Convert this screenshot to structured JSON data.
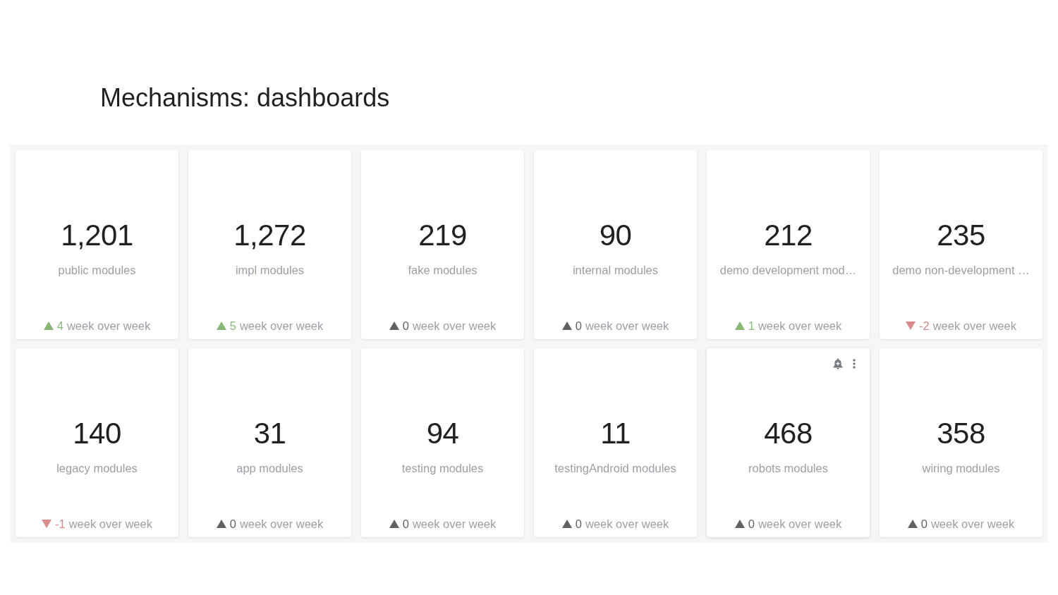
{
  "title": "Mechanisms: dashboards",
  "cards": [
    {
      "value": "1,201",
      "label": "public modules",
      "kind": "up",
      "delta": "4",
      "period": "week over week",
      "actions_shown": false
    },
    {
      "value": "1,272",
      "label": "impl modules",
      "kind": "up",
      "delta": "5",
      "period": "week over week",
      "actions_shown": false
    },
    {
      "value": "219",
      "label": "fake modules",
      "kind": "flat",
      "delta": "0",
      "period": "week over week",
      "actions_shown": false
    },
    {
      "value": "90",
      "label": "internal modules",
      "kind": "flat",
      "delta": "0",
      "period": "week over week",
      "actions_shown": false
    },
    {
      "value": "212",
      "label": "demo development mod…",
      "kind": "up",
      "delta": "1",
      "period": "week over week",
      "actions_shown": false
    },
    {
      "value": "235",
      "label": "demo non-development …",
      "kind": "down",
      "delta": "-2",
      "period": "week over week",
      "actions_shown": false
    },
    {
      "value": "140",
      "label": "legacy modules",
      "kind": "down",
      "delta": "-1",
      "period": "week over week",
      "actions_shown": false
    },
    {
      "value": "31",
      "label": "app modules",
      "kind": "flat",
      "delta": "0",
      "period": "week over week",
      "actions_shown": false
    },
    {
      "value": "94",
      "label": "testing modules",
      "kind": "flat",
      "delta": "0",
      "period": "week over week",
      "actions_shown": false
    },
    {
      "value": "11",
      "label": "testingAndroid modules",
      "kind": "flat",
      "delta": "0",
      "period": "week over week",
      "actions_shown": false
    },
    {
      "value": "468",
      "label": "robots modules",
      "kind": "flat",
      "delta": "0",
      "period": "week over week",
      "actions_shown": true
    },
    {
      "value": "358",
      "label": "wiring modules",
      "kind": "flat",
      "delta": "0",
      "period": "week over week",
      "actions_shown": false
    }
  ]
}
